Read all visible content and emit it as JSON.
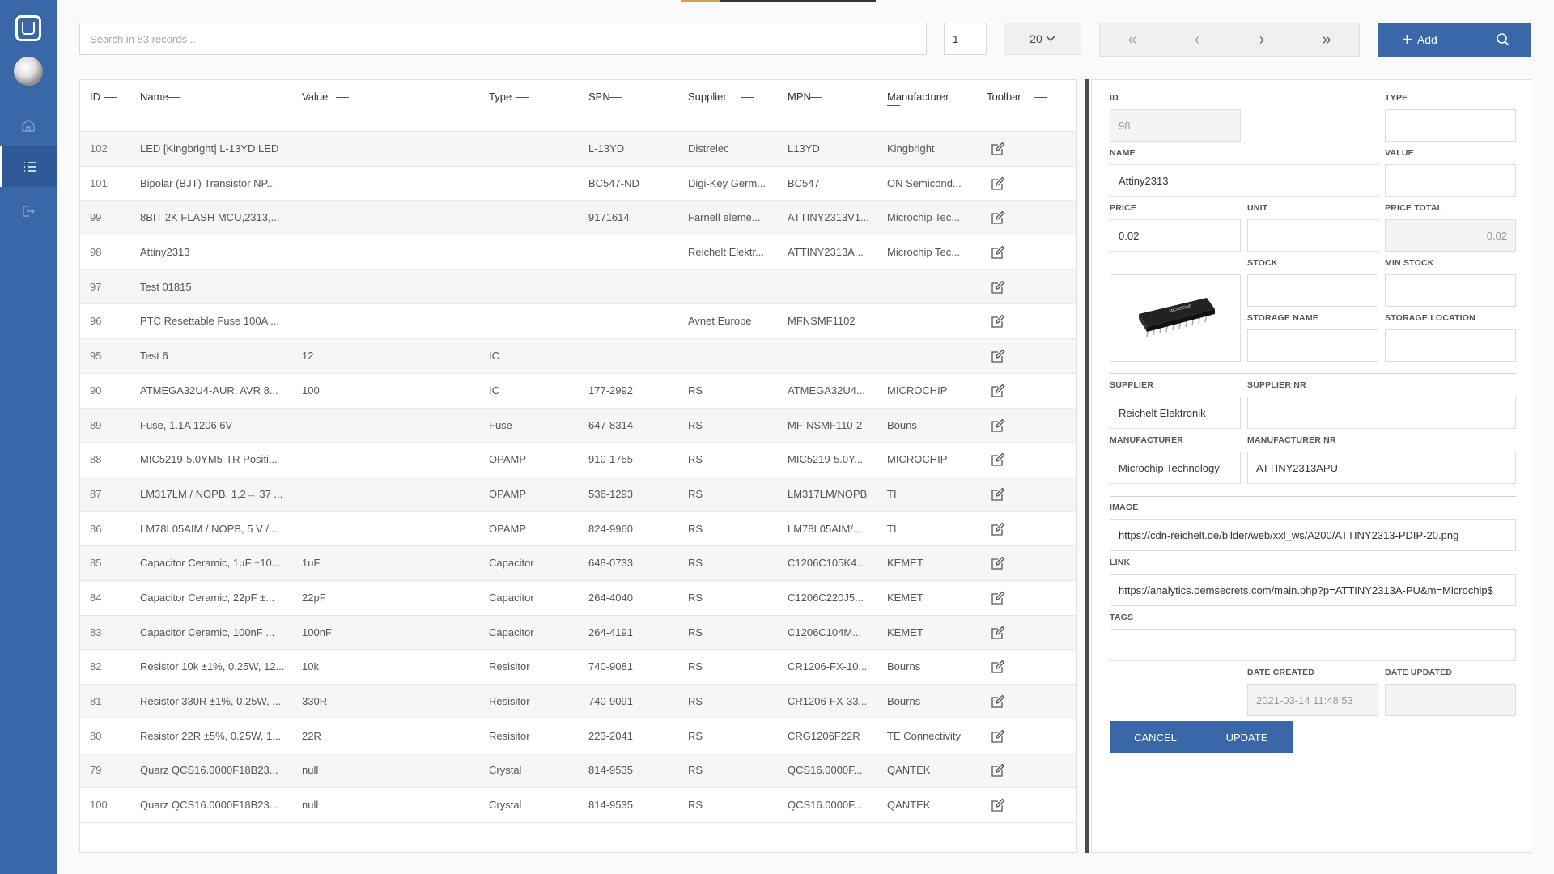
{
  "sidebar": {
    "items": [
      {
        "name": "home-icon"
      },
      {
        "name": "list-icon"
      },
      {
        "name": "logout-icon"
      }
    ]
  },
  "toolbar": {
    "search_placeholder": "Search in 83 records ...",
    "page": "1",
    "per_page": "20",
    "pager": [
      "«",
      "‹",
      "›",
      "»"
    ],
    "add_label": "Add"
  },
  "table": {
    "headers": [
      "ID",
      "Name",
      "Value",
      "Type",
      "SPN",
      "Supplier",
      "MPN",
      "Manufacturer",
      "Toolbar"
    ],
    "rows": [
      [
        "102",
        "LED [Kingbright] L-13YD LED",
        "",
        "",
        "L-13YD",
        "Distrelec",
        "L13YD",
        "Kingbright"
      ],
      [
        "101",
        "Bipolar (BJT) Transistor NP...",
        "",
        "",
        "BC547-ND",
        "Digi-Key Germ...",
        "BC547",
        "ON Semicond..."
      ],
      [
        "99",
        "8BIT 2K FLASH MCU,2313,...",
        "",
        "",
        "9171614",
        "Farnell eleme...",
        "ATTINY2313V1...",
        "Microchip Tec..."
      ],
      [
        "98",
        "Attiny2313",
        "",
        "",
        "",
        "Reichelt Elektr...",
        "ATTINY2313A...",
        "Microchip Tec..."
      ],
      [
        "97",
        "Test 01815",
        "",
        "",
        "",
        "",
        "",
        ""
      ],
      [
        "96",
        "PTC Resettable Fuse 100A ...",
        "",
        "",
        "",
        "Avnet Europe",
        "MFNSMF1102",
        ""
      ],
      [
        "95",
        "Test 6",
        "12",
        "IC",
        "",
        "",
        "",
        ""
      ],
      [
        "90",
        "ATMEGA32U4-AUR, AVR 8...",
        "100",
        "IC",
        "177-2992",
        "RS",
        "ATMEGA32U4...",
        "MICROCHIP"
      ],
      [
        "89",
        "Fuse, 1.1A 1206 6V",
        "",
        "Fuse",
        "647-8314",
        "RS",
        "MF-NSMF110-2",
        "Bouns"
      ],
      [
        "88",
        "MIC5219-5.0YM5-TR Positi...",
        "",
        "OPAMP",
        "910-1755",
        "RS",
        "MIC5219-5.0Y...",
        "MICROCHIP"
      ],
      [
        "87",
        "LM317LM / NOPB, 1,2→ 37 ...",
        "",
        "OPAMP",
        "536-1293",
        "RS",
        "LM317LM/NOPB",
        "TI"
      ],
      [
        "86",
        "LM78L05AIM / NOPB, 5 V /...",
        "",
        "OPAMP",
        "824-9960",
        "RS",
        "LM78L05AIM/...",
        "TI"
      ],
      [
        "85",
        "Capacitor Ceramic, 1µF ±10...",
        "1uF",
        "Capacitor",
        "648-0733",
        "RS",
        "C1206C105K4...",
        "KEMET"
      ],
      [
        "84",
        "Capacitor Ceramic, 22pF ±...",
        "22pF",
        "Capacitor",
        "264-4040",
        "RS",
        "C1206C220J5...",
        "KEMET"
      ],
      [
        "83",
        "Capacitor Ceramic, 100nF ...",
        "100nF",
        "Capacitor",
        "264-4191",
        "RS",
        "C1206C104M...",
        "KEMET"
      ],
      [
        "82",
        "Resistor 10k ±1%, 0.25W, 12...",
        "10k",
        "Resisitor",
        "740-9081",
        "RS",
        "CR1206-FX-10...",
        "Bourns"
      ],
      [
        "81",
        "Resistor 330R ±1%, 0.25W, ...",
        "330R",
        "Resisitor",
        "740-9091",
        "RS",
        "CR1206-FX-33...",
        "Bourns"
      ],
      [
        "80",
        "Resistor 22R ±5%, 0.25W, 1...",
        "22R",
        "Resisitor",
        "223-2041",
        "RS",
        "CRG1206F22R",
        "TE Connectivity"
      ],
      [
        "79",
        "Quarz QCS16.0000F18B23...",
        "null",
        "Crystal",
        "814-9535",
        "RS",
        "QCS16.0000F...",
        "QANTEK"
      ],
      [
        "100",
        "Quarz QCS16.0000F18B23...",
        "null",
        "Crystal",
        "814-9535",
        "RS",
        "QCS16.0000F...",
        "QANTEK"
      ]
    ]
  },
  "form": {
    "labels": {
      "id": "ID",
      "type": "TYPE",
      "name": "NAME",
      "value": "VALUE",
      "price": "PRICE",
      "unit": "UNIT",
      "price_total": "PRICE TOTAL",
      "stock": "STOCK",
      "min_stock": "MIN STOCK",
      "storage_name": "STORAGE NAME",
      "storage_location": "STORAGE LOCATION",
      "supplier": "SUPPLIER",
      "supplier_nr": "SUPPLIER NR",
      "manufacturer": "MANUFACTURER",
      "manufacturer_nr": "MANUFACTURER NR",
      "image": "IMAGE",
      "link": "LINK",
      "tags": "TAGS",
      "date_created": "DATE CREATED",
      "date_updated": "DATE UPDATED"
    },
    "values": {
      "id": "98",
      "type": "",
      "name": "Attiny2313",
      "value": "",
      "price": "0.02",
      "unit": "",
      "price_total": "0.02",
      "stock": "",
      "min_stock": "",
      "storage_name": "",
      "storage_location": "",
      "supplier": "Reichelt Elektronik",
      "supplier_nr": "",
      "manufacturer": "Microchip Technology",
      "manufacturer_nr": "ATTINY2313APU",
      "image": "https://cdn-reichelt.de/bilder/web/xxl_ws/A200/ATTINY2313-PDIP-20.png",
      "link": "https://analytics.oemsecrets.com/main.php?p=ATTINY2313A-PU&m=Microchip$",
      "tags": "",
      "date_created": "2021-03-14 11:48:53",
      "date_updated": ""
    },
    "cancel_label": "CANCEL",
    "update_label": "UPDATE"
  },
  "colors": {
    "sidebar": "#3a67a8",
    "primary_button": "#3a67a8"
  }
}
